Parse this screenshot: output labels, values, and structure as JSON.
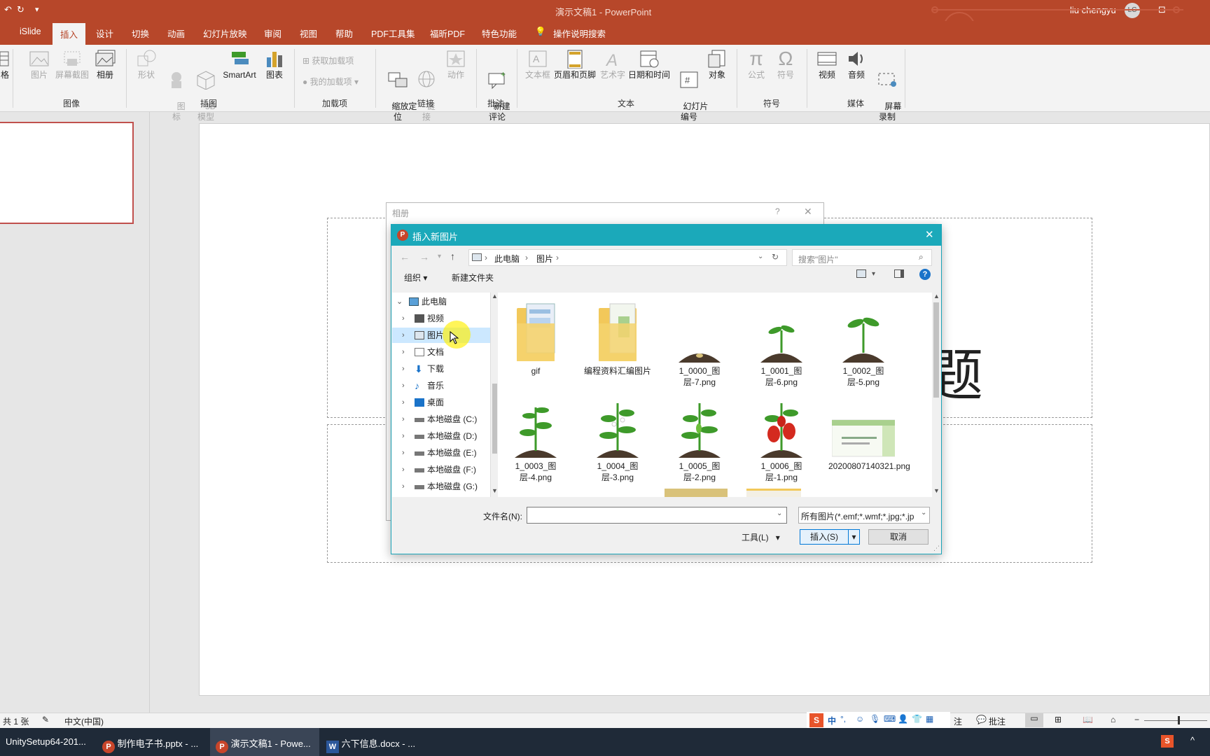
{
  "titlebar": {
    "title": "演示文稿1 - PowerPoint",
    "user": "liu chengyu",
    "avatar": "LC",
    "icons": [
      "undo-icon",
      "customize-quick-access-icon"
    ]
  },
  "tabs": [
    "iSlide",
    "插入",
    "设计",
    "切换",
    "动画",
    "幻灯片放映",
    "审阅",
    "视图",
    "帮助",
    "PDF工具集",
    "福昕PDF",
    "特色功能",
    "操作说明搜索"
  ],
  "ribbon": {
    "partial": "格",
    "images": {
      "group": "图像",
      "picture": "图片",
      "screenshot": "屏幕截图",
      "album": "相册"
    },
    "illus": {
      "group": "插图",
      "shapes": "形状",
      "icons": "图\n标",
      "models": "3D\n模型",
      "smartart": "SmartArt",
      "chart": "图表"
    },
    "addins": {
      "group": "加载项",
      "get": "获取加载项",
      "mine": "我的加载项"
    },
    "links": {
      "group": "链接",
      "zoom": "缩放定\n位",
      "link": "链\n接",
      "action": "动作"
    },
    "comments": {
      "group": "批注",
      "new": "新建\n评论"
    },
    "text": {
      "group": "文本",
      "textbox": "文本框",
      "header": "页眉和页脚",
      "wordart": "艺术字",
      "datetime": "日期和时间",
      "slidenum": "幻灯片\n编号",
      "object": "对象"
    },
    "symbols": {
      "group": "符号",
      "equation": "公式",
      "symbol": "符号"
    },
    "media": {
      "group": "媒体",
      "video": "视频",
      "audio": "音频",
      "record": "屏幕\n录制"
    }
  },
  "album_dialog": {
    "title": "相册",
    "help": "?",
    "close": "✕"
  },
  "dialog": {
    "title": "插入新图片",
    "breadcrumb": [
      "此电脑",
      "图片"
    ],
    "search_placeholder": "搜索\"图片\"",
    "organize": "组织",
    "new_folder": "新建文件夹",
    "help": "?",
    "tree": [
      "此电脑",
      "视频",
      "图片",
      "文档",
      "下载",
      "音乐",
      "桌面",
      "本地磁盘 (C:)",
      "本地磁盘 (D:)",
      "本地磁盘 (E:)",
      "本地磁盘 (F:)",
      "本地磁盘 (G:)"
    ],
    "selected_tree": "图片",
    "files": [
      {
        "name": "gif",
        "kind": "folder"
      },
      {
        "name": "编程资料汇编图片",
        "kind": "folder"
      },
      {
        "name": "1_0000_图层-7.png",
        "kind": "soil"
      },
      {
        "name": "1_0001_图层-6.png",
        "kind": "sprout"
      },
      {
        "name": "1_0002_图层-5.png",
        "kind": "sprout"
      },
      {
        "name": "1_0003_图层-4.png",
        "kind": "plant"
      },
      {
        "name": "1_0004_图层-3.png",
        "kind": "flower"
      },
      {
        "name": "1_0005_图层-2.png",
        "kind": "plant"
      },
      {
        "name": "1_0006_图层-1.png",
        "kind": "pepper"
      },
      {
        "name": "20200807140321.png",
        "kind": "slide"
      }
    ],
    "filename_label": "文件名(N):",
    "filename_value": "",
    "filetype": "所有图片(*.emf;*.wmf;*.jpg;*.jp",
    "tools": "工具(L)",
    "insert": "插入(S)",
    "cancel": "取消"
  },
  "statusbar": {
    "slides": "共 1 张",
    "language": "中文(中国)",
    "comments": "批注",
    "notes": "注",
    "ime": "中"
  },
  "taskbar": [
    "UnitySetup64-201...",
    "制作电子书.pptx - ...",
    "演示文稿1 - Powe...",
    "六下信息.docx - ..."
  ],
  "colors": {
    "accent": "#b7472a",
    "dialog": "#1ba9ba",
    "taskbar": "#1f2a38",
    "leaf": "#3e9a2a",
    "pepper": "#d42a1f",
    "soil": "#4a3a2c"
  }
}
